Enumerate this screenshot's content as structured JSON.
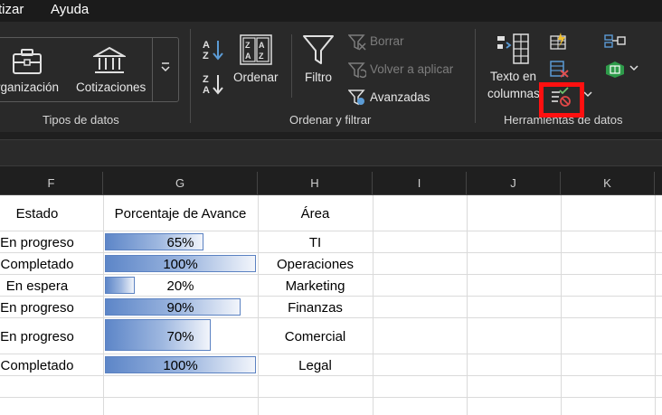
{
  "menu": {
    "item_partial": "tizar",
    "help": "Ayuda"
  },
  "ribbon": {
    "data_types": {
      "organization_label": "rganización",
      "quotes_label": "Cotizaciones",
      "group_label": "Tipos de datos"
    },
    "sort_filter": {
      "sort_label": "Ordenar",
      "filter_label": "Filtro",
      "clear_label": "Borrar",
      "reapply_label": "Volver a aplicar",
      "advanced_label": "Avanzadas",
      "group_label": "Ordenar y filtrar"
    },
    "data_tools": {
      "text_to_columns_line1": "Texto en",
      "text_to_columns_line2": "columnas",
      "group_label": "Herramientas de datos"
    }
  },
  "sheet": {
    "columns": [
      "F",
      "G",
      "H",
      "I",
      "J",
      "K"
    ],
    "header_row": {
      "estado": "Estado",
      "avance": "Porcentaje de Avance",
      "area": "Área"
    },
    "rows": [
      {
        "estado": "En progreso",
        "avance_label": "65%",
        "avance": 0.65,
        "area": "TI"
      },
      {
        "estado": "Completado",
        "avance_label": "100%",
        "avance": 1.0,
        "area": "Operaciones"
      },
      {
        "estado": "En espera",
        "avance_label": "20%",
        "avance": 0.2,
        "area": "Marketing"
      },
      {
        "estado": "En progreso",
        "avance_label": "90%",
        "avance": 0.9,
        "area": "Finanzas"
      },
      {
        "estado": "En progreso",
        "avance_label": "70%",
        "avance": 0.7,
        "area": "Comercial"
      },
      {
        "estado": "Completado",
        "avance_label": "100%",
        "avance": 1.0,
        "area": "Legal"
      }
    ]
  },
  "colors": {
    "highlight": "#ff1010",
    "databar": "#5d86c8",
    "ribbon_bg": "#292929"
  }
}
